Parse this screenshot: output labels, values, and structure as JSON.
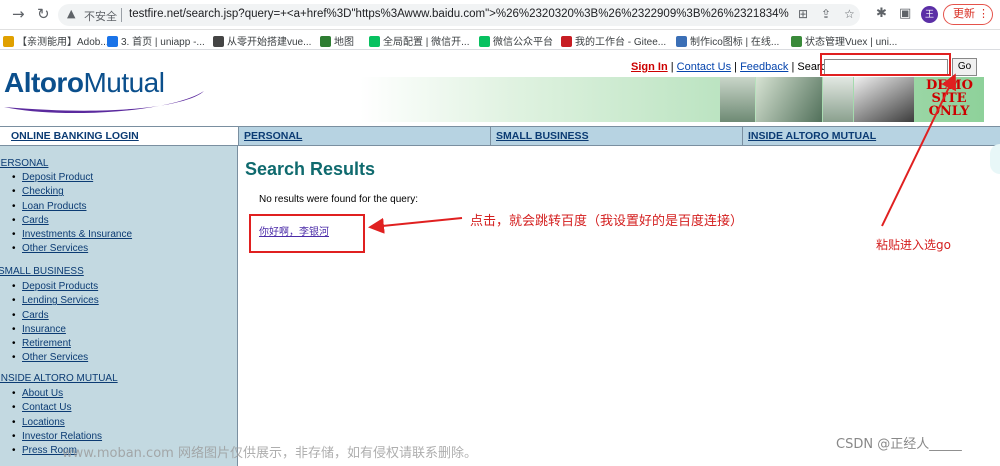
{
  "browser": {
    "insecure_label": "不安全",
    "url": "testfire.net/search.jsp?query=+<a+href%3D\"https%3Awww.baidu.com\">%26%2320320%3B%26%2322909%3B%26%2321834%3...",
    "avatar_letter": "王",
    "update_label": "更新",
    "bookmarks": [
      "【亲测能用】Adob...",
      "3. 首页 | uniapp -...",
      "从零开始搭建vue...",
      "地图",
      "全局配置 | 微信开...",
      "微信公众平台",
      "我的工作台 - Gitee...",
      "制作ico图标 | 在线...",
      "状态管理Vuex | uni..."
    ],
    "bookmark_colors": [
      "#e0a000",
      "#1a73e8",
      "#444444",
      "#2e7d32",
      "#07c160",
      "#07c160",
      "#c71d23",
      "#3b6fb6",
      "#3a8a3a"
    ]
  },
  "site": {
    "logo_part1": "Altoro",
    "logo_part2": "Mutual",
    "signin": "Sign In",
    "contact": "Contact Us",
    "feedback": "Feedback",
    "search_label": "Search",
    "search_value": "",
    "go": "Go",
    "demo_line1": "DEMO",
    "demo_line2": "SITE",
    "demo_line3": "ONLY",
    "nav": {
      "login": "ONLINE BANKING LOGIN",
      "personal": "PERSONAL",
      "small_business": "SMALL BUSINESS",
      "inside": "INSIDE ALTORO MUTUAL"
    },
    "sidebar": {
      "personal_head": "PERSONAL",
      "personal_items": [
        "Deposit Product",
        "Checking",
        "Loan Products",
        "Cards",
        "Investments & Insurance",
        "Other Services"
      ],
      "business_head": "SMALL BUSINESS",
      "business_items": [
        "Deposit Products",
        "Lending Services",
        "Cards",
        "Insurance",
        "Retirement",
        "Other Services"
      ],
      "inside_head": "INSIDE ALTORO MUTUAL",
      "inside_items": [
        "About Us",
        "Contact Us",
        "Locations",
        "Investor Relations",
        "Press Room"
      ]
    },
    "content": {
      "title": "Search Results",
      "no_results": "No results were found for the query:",
      "result_link": "你好啊，李银河"
    }
  },
  "annotations": {
    "click_note": "点击，就会跳转百度（我设置好的是百度连接）",
    "paste_note": "粘贴进入选go"
  },
  "watermarks": {
    "left": "www.moban.com 网络图片仅供展示，非存储，如有侵权请联系删除。",
    "right": "CSDN @正经人_____"
  }
}
